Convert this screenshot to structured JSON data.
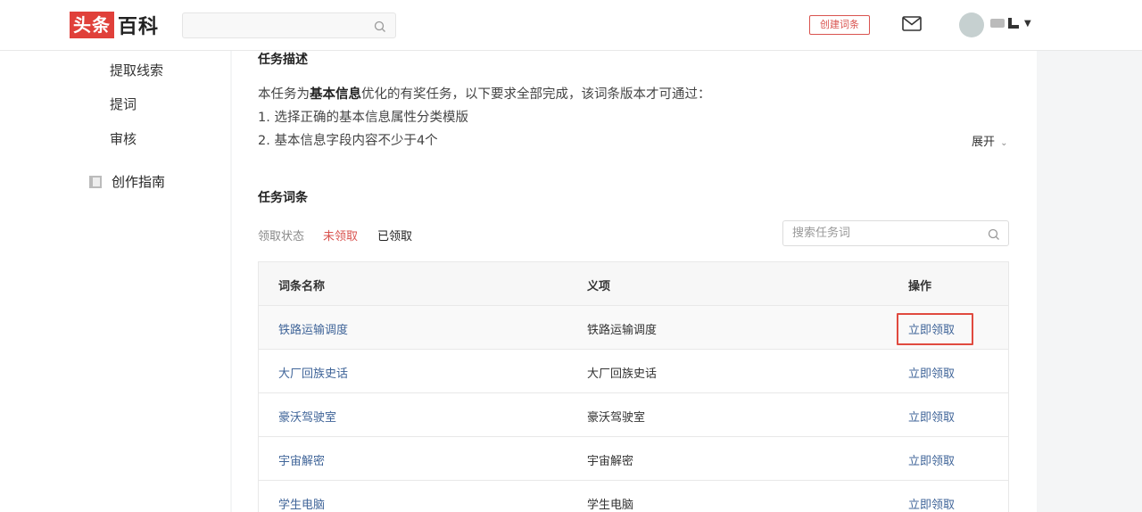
{
  "header": {
    "logo_part1": "头条",
    "logo_part2": "百科",
    "search_placeholder": "",
    "create_label": "创建词条"
  },
  "sidebar": {
    "items": [
      {
        "label": "提取线索"
      },
      {
        "label": "提词"
      },
      {
        "label": "审核"
      }
    ],
    "guide_label": "创作指南"
  },
  "task_description": {
    "title": "任务描述",
    "intro_prefix": "本任务为",
    "intro_bold": "基本信息",
    "intro_suffix": "优化的有奖任务，以下要求全部完成，该词条版本才可通过：",
    "req1": "1. 选择正确的基本信息属性分类模版",
    "req2": "2. 基本信息字段内容不少于4个",
    "expand_label": "展开"
  },
  "task_entries": {
    "title": "任务词条",
    "filter_label": "领取状态",
    "filter_unclaimed": "未领取",
    "filter_claimed": "已领取",
    "search_placeholder": "搜索任务词",
    "columns": {
      "name": "词条名称",
      "sense": "义项",
      "action": "操作"
    },
    "rows": [
      {
        "name": "铁路运输调度",
        "sense": "铁路运输调度",
        "action": "立即领取"
      },
      {
        "name": "大厂回族史话",
        "sense": "大厂回族史话",
        "action": "立即领取"
      },
      {
        "name": "豪沃驾驶室",
        "sense": "豪沃驾驶室",
        "action": "立即领取"
      },
      {
        "name": "宇宙解密",
        "sense": "宇宙解密",
        "action": "立即领取"
      },
      {
        "name": "学生电脑",
        "sense": "学生电脑",
        "action": "立即领取"
      }
    ]
  },
  "colors": {
    "brand_red": "#e0403a",
    "link_blue": "#406599",
    "active_filter": "#d9534f"
  }
}
